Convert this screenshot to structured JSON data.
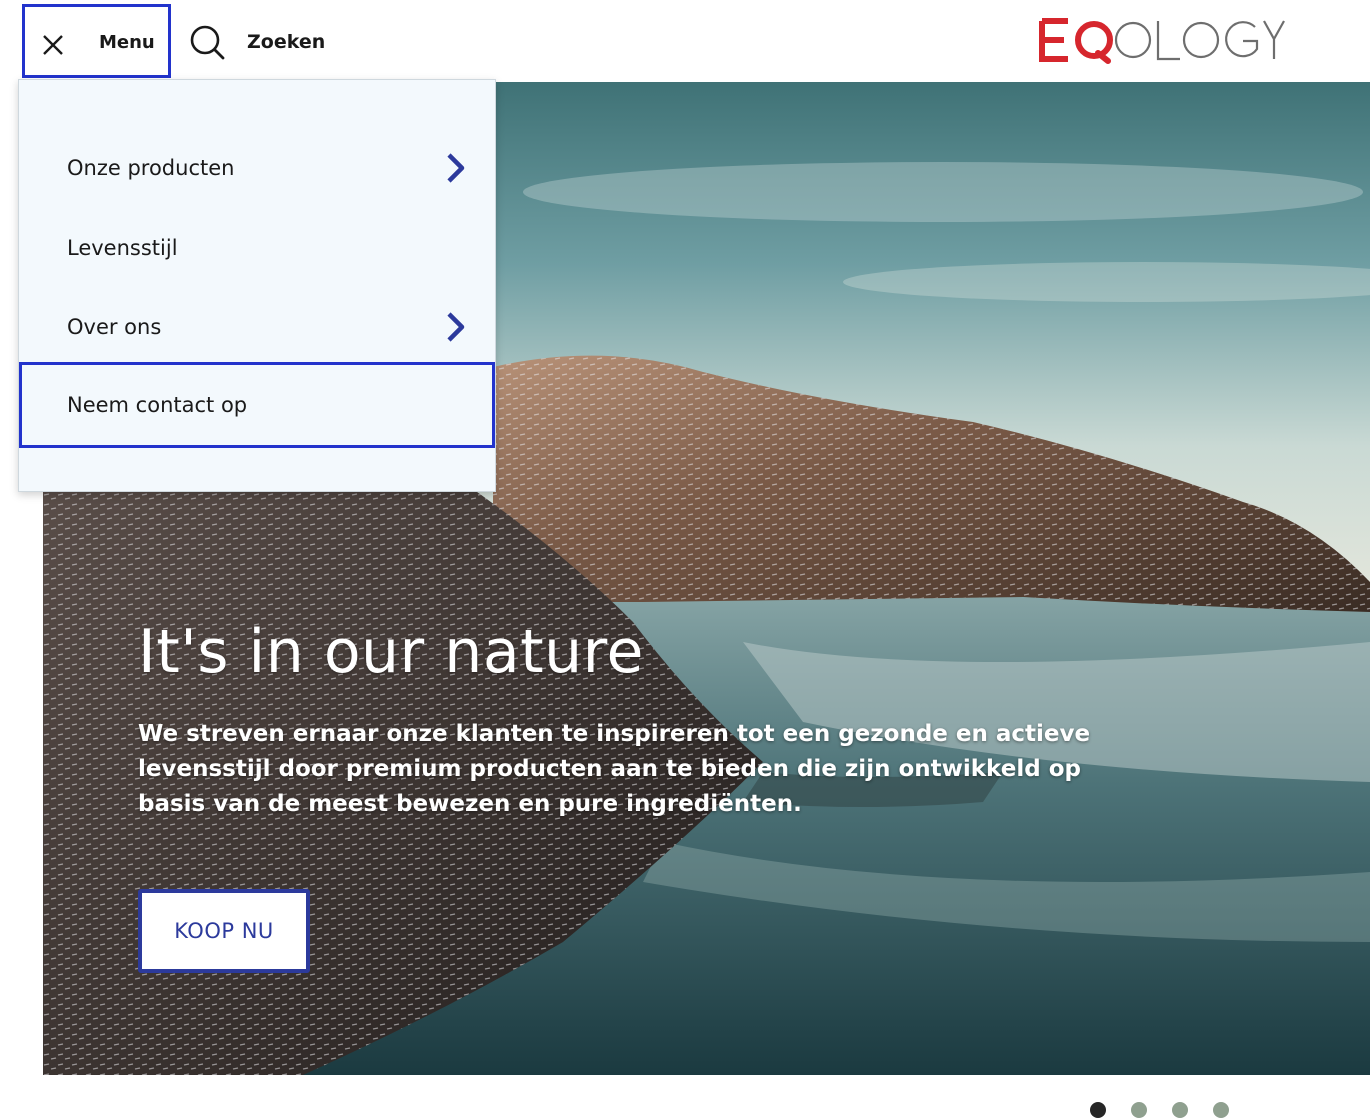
{
  "header": {
    "menu_label": "Menu",
    "search_label": "Zoeken",
    "logo_text": "EQOLOGY",
    "focus_color": "#2233cc"
  },
  "menu": {
    "items": [
      {
        "label": "Onze producten",
        "has_submenu": true
      },
      {
        "label": "Levensstijl",
        "has_submenu": false
      },
      {
        "label": "Over ons",
        "has_submenu": true
      },
      {
        "label": "Neem contact op",
        "has_submenu": false,
        "focused": true
      }
    ]
  },
  "hero": {
    "title": "It's in our nature",
    "text": "We streven ernaar onze klanten te inspireren tot een gezonde en actieve levensstijl door premium producten aan te bieden die zijn ontwikkeld op basis van de meest bewezen en pure ingrediënten.",
    "cta_label": "KOOP NU",
    "cta_color": "#2c3a9c"
  },
  "carousel": {
    "slide_count": 4,
    "active_slide": 1
  },
  "colors": {
    "chevron": "#2c3a9c",
    "logo_red": "#d6262d",
    "logo_grey": "#6e6e6e",
    "dot_inactive": "#8fa08f",
    "dot_active": "#262626"
  }
}
